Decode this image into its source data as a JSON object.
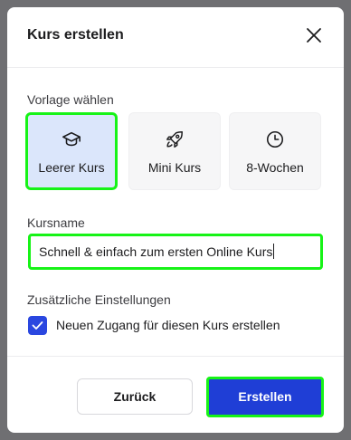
{
  "dialog": {
    "title": "Kurs erstellen"
  },
  "template_section": {
    "label": "Vorlage wählen",
    "options": [
      {
        "label": "Leerer Kurs",
        "icon": "graduation-cap-icon",
        "selected": true
      },
      {
        "label": "Mini Kurs",
        "icon": "rocket-icon",
        "selected": false
      },
      {
        "label": "8-Wochen",
        "icon": "clock-icon",
        "selected": false
      }
    ]
  },
  "course_name": {
    "label": "Kursname",
    "value": "Schnell & einfach zum ersten Online Kurs"
  },
  "extra_settings": {
    "label": "Zusätzliche Einstellungen",
    "checkbox_label": "Neuen Zugang für diesen Kurs erstellen",
    "checked": true
  },
  "footer": {
    "back_label": "Zurück",
    "create_label": "Erstellen"
  },
  "colors": {
    "accent": "#1f3ed6",
    "checkbox": "#2a47e0",
    "selected_card_bg": "#dbe6fb",
    "highlight": "#17f317"
  }
}
